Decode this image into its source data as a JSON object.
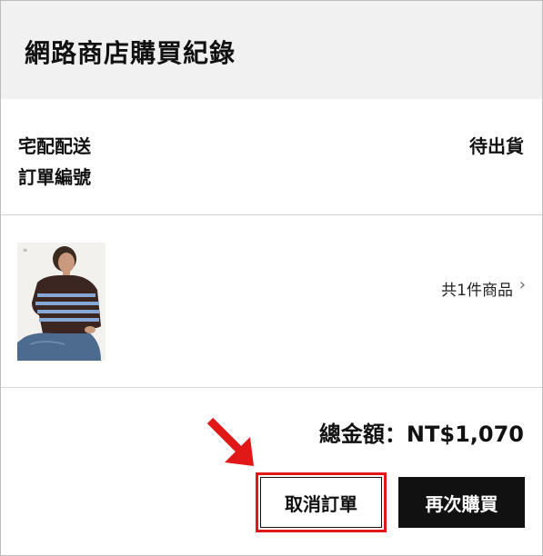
{
  "header": {
    "title": "網路商店購買紀錄"
  },
  "order": {
    "shipping_method": "宅配配送",
    "order_number_label": "訂單編號",
    "status": "待出貨",
    "items_summary": "共1件商品",
    "chevron_glyph": "›",
    "total_label": "總金額：NT$1,070"
  },
  "actions": {
    "cancel_label": "取消訂單",
    "rebuy_label": "再次購買"
  },
  "colors": {
    "highlight": "#e01818",
    "header_bg": "#f1f1f1",
    "primary_button": "#111111"
  },
  "icons": {
    "product_image": "striped-sweater-photo",
    "pointer": "red-arrow-icon"
  }
}
